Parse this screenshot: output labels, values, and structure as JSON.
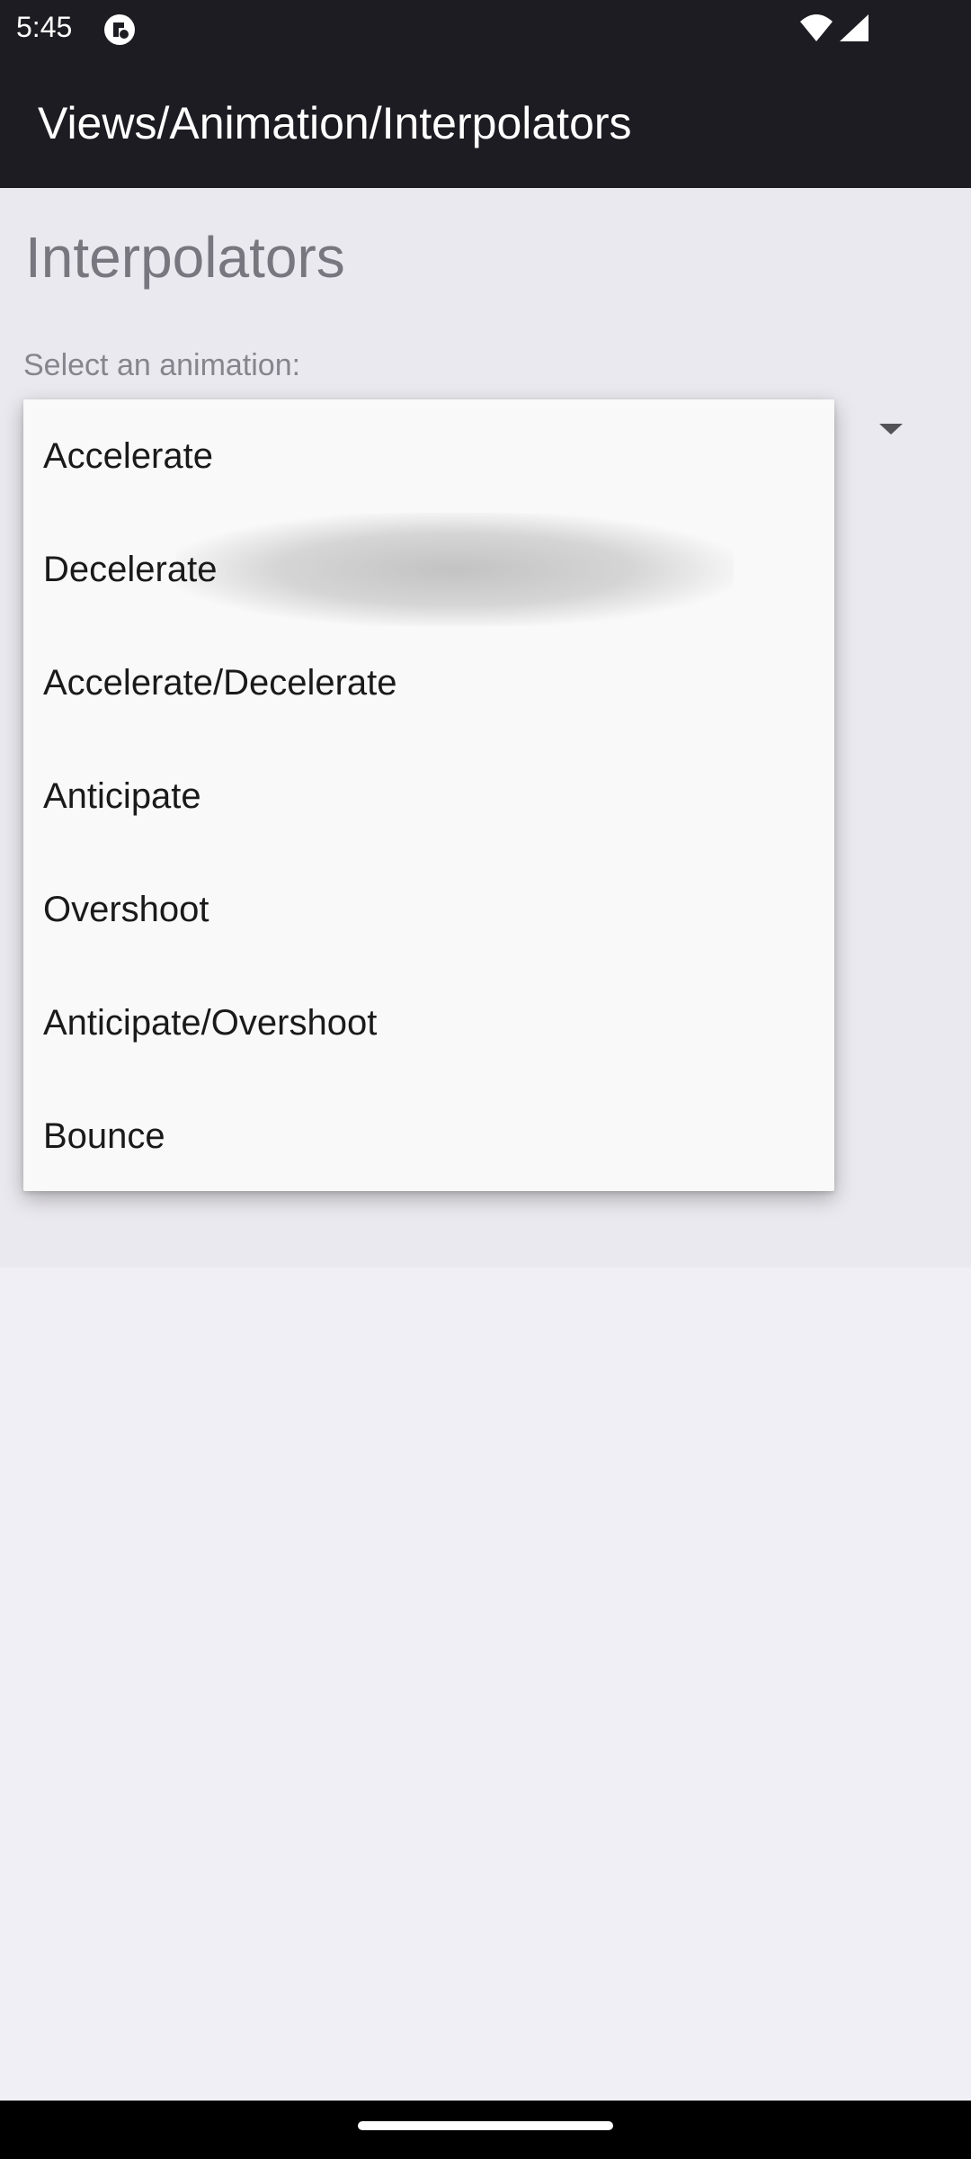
{
  "status_bar": {
    "time": "5:45"
  },
  "app_bar": {
    "title": "Views/Animation/Interpolators"
  },
  "page": {
    "heading": "Interpolators",
    "spinner_label": "Select an animation:"
  },
  "dropdown": {
    "items": [
      {
        "label": "Accelerate"
      },
      {
        "label": "Decelerate"
      },
      {
        "label": "Accelerate/Decelerate"
      },
      {
        "label": "Anticipate"
      },
      {
        "label": "Overshoot"
      },
      {
        "label": "Anticipate/Overshoot"
      },
      {
        "label": "Bounce"
      }
    ],
    "pressed_item": "Decelerate"
  },
  "icons": {
    "app_status": "app-status-icon",
    "wifi": "wifi-icon",
    "signal": "cellular-signal-icon",
    "dropdown_arrow": "dropdown-arrow-icon"
  },
  "colors": {
    "app_bar": "#1d1c22",
    "background": "#f0eff5",
    "menu_surface": "#f9f9f9"
  }
}
